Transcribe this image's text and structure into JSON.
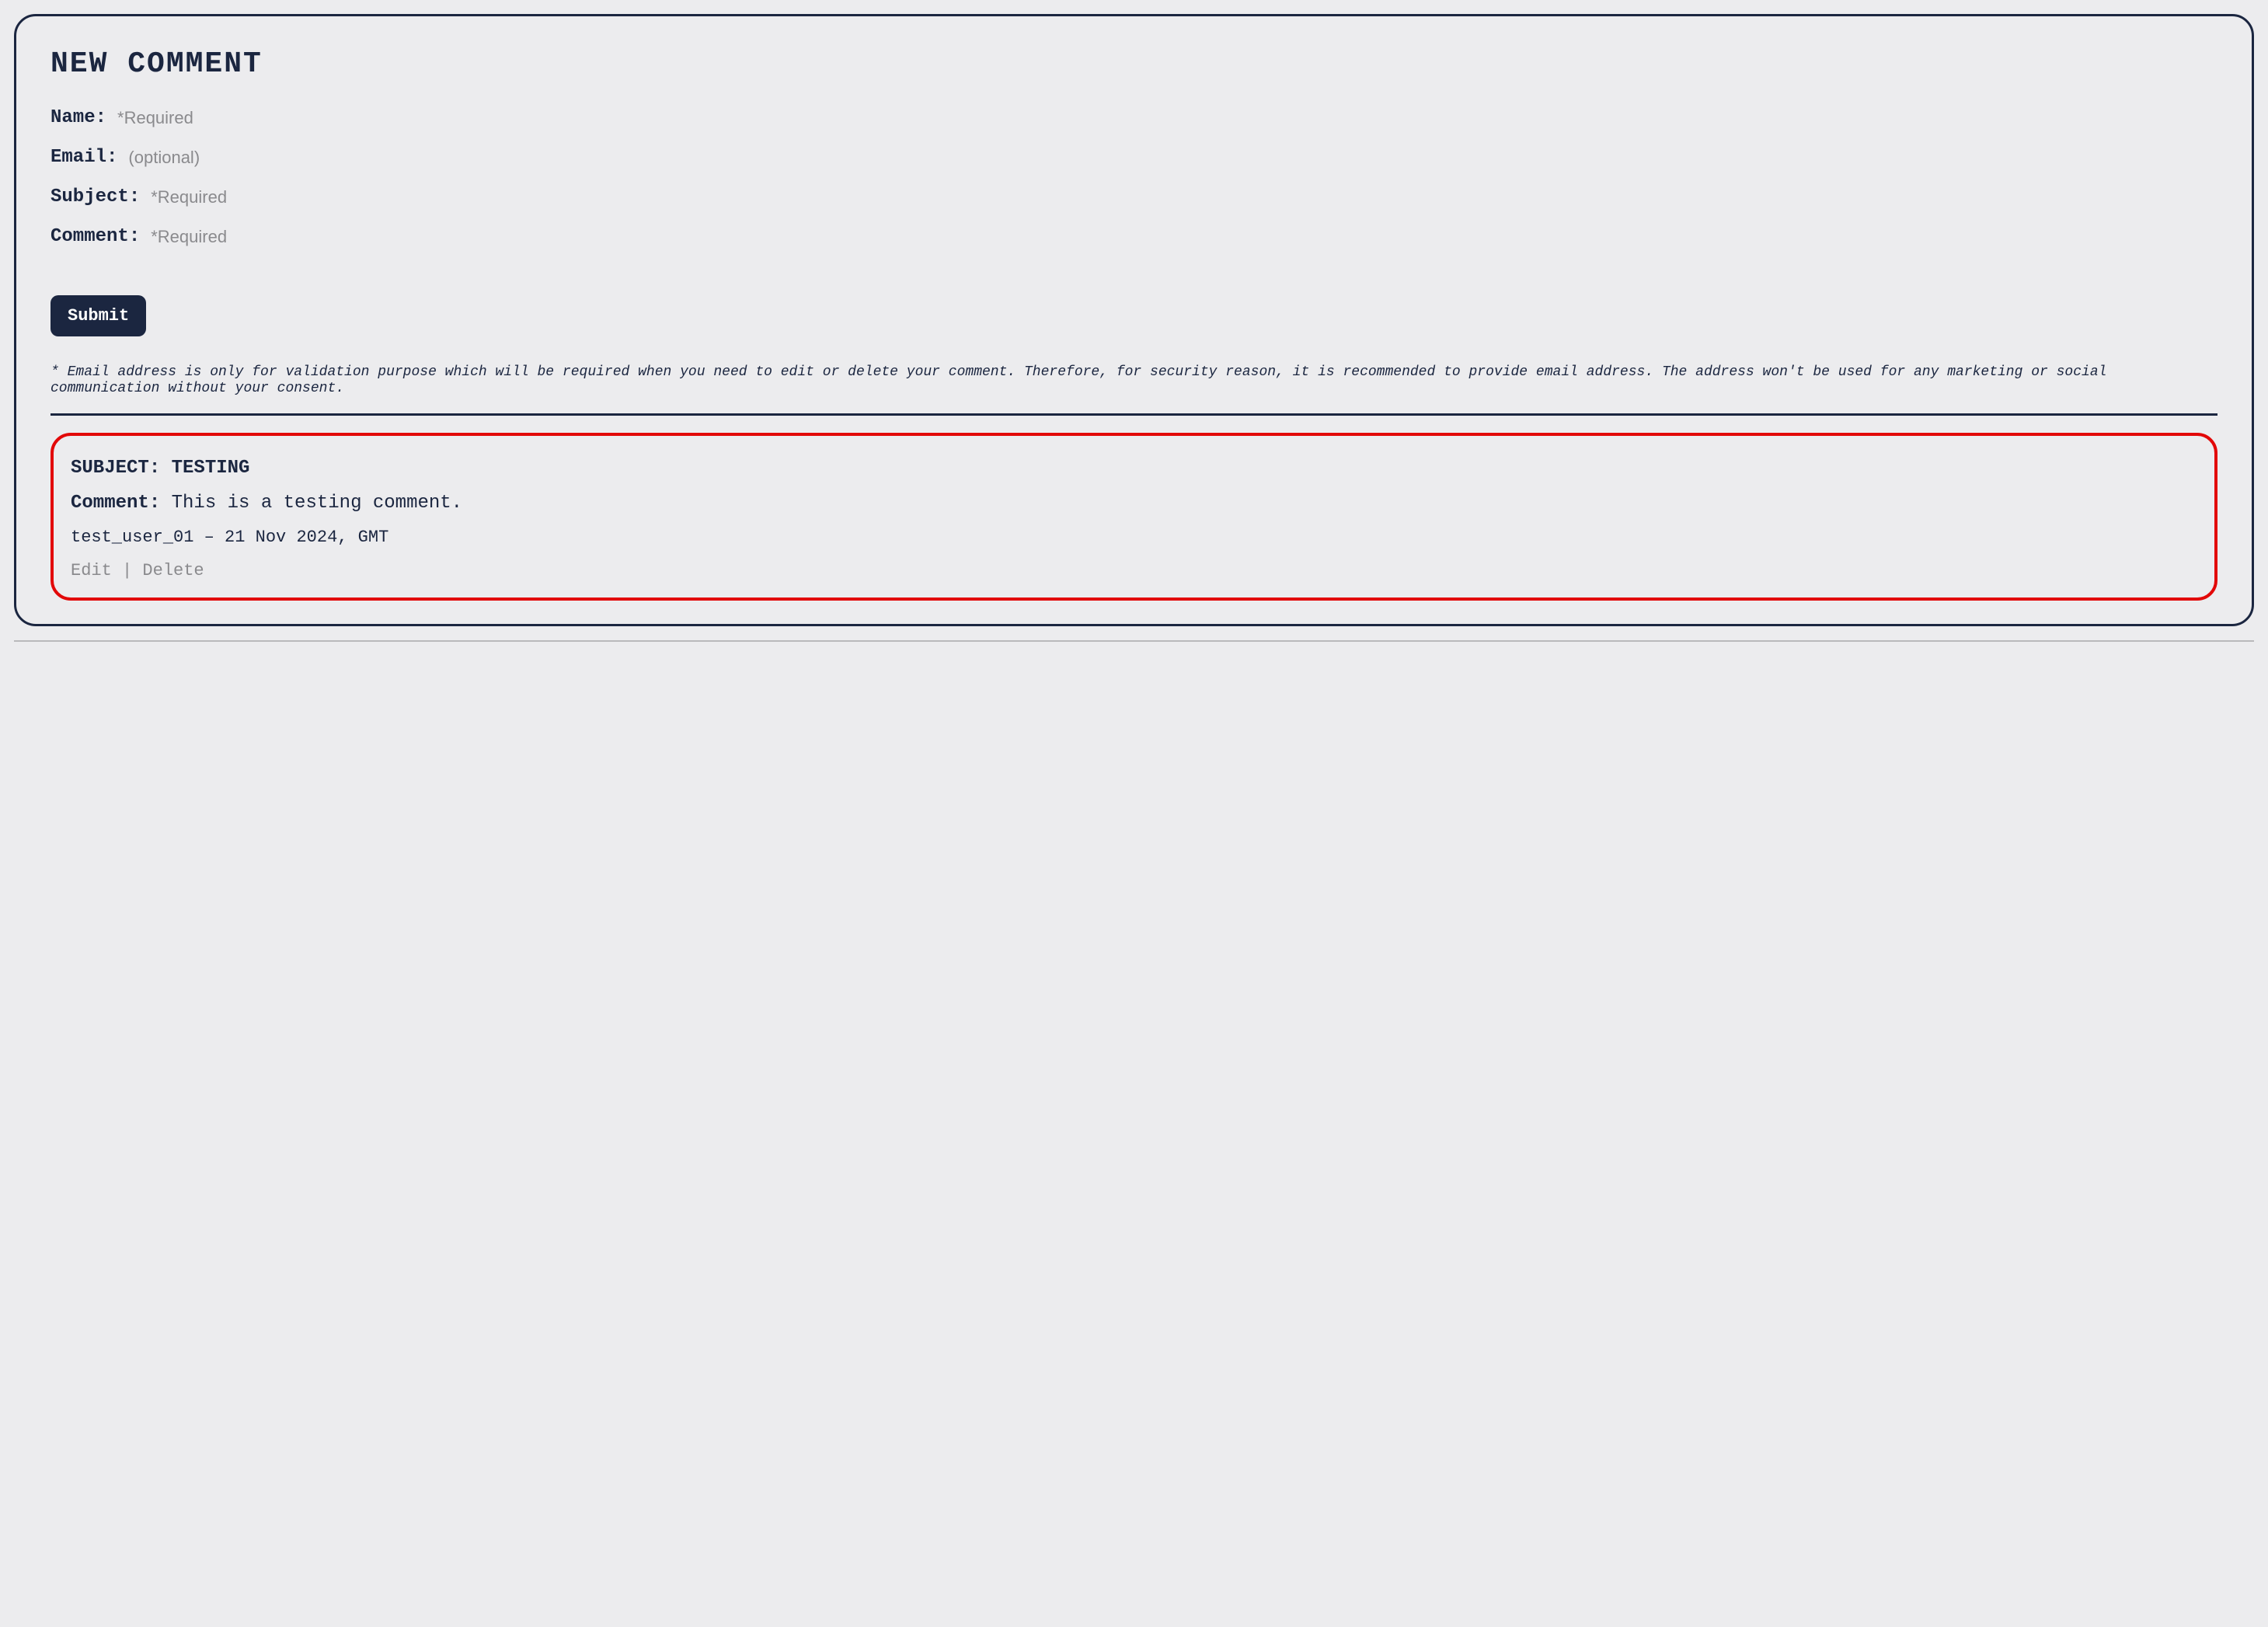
{
  "form": {
    "title": "NEW COMMENT",
    "name_label": "Name:",
    "name_placeholder": "*Required",
    "email_label": "Email:",
    "email_placeholder": "(optional)",
    "subject_label": "Subject:",
    "subject_placeholder": "*Required",
    "comment_label": "Comment:",
    "comment_placeholder": "*Required",
    "submit_label": "Submit",
    "disclaimer": "* Email address is only for validation purpose which will be required when you need to edit or delete your comment. Therefore, for security reason, it is recommended to provide email address. The address won't be used for any marketing or social communication without your consent."
  },
  "comment": {
    "subject_label": "SUBJECT:",
    "subject_value": "TESTING",
    "body_label": "Comment:",
    "body_value": "This is a testing comment.",
    "author": "test_user_01",
    "separator": " – ",
    "date": "21 Nov 2024, GMT",
    "edit_label": "Edit",
    "delete_label": "Delete",
    "action_separator": " | "
  }
}
